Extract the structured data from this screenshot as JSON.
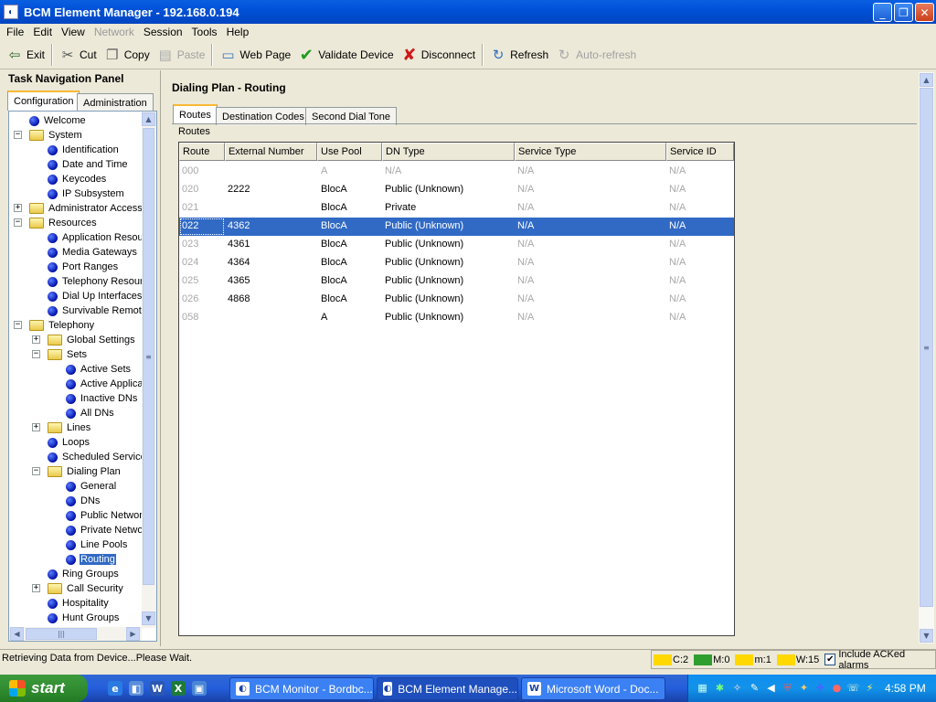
{
  "window": {
    "title": "BCM Element Manager - 192.168.0.194",
    "minimize": "_",
    "maximize": "❐",
    "close": "✕"
  },
  "menu": [
    "File",
    "Edit",
    "View",
    "Network",
    "Session",
    "Tools",
    "Help"
  ],
  "menu_disabled": [
    "Network"
  ],
  "toolbar": {
    "exit": "Exit",
    "cut": "Cut",
    "copy": "Copy",
    "paste": "Paste",
    "web_page": "Web Page",
    "validate_device": "Validate Device",
    "disconnect": "Disconnect",
    "refresh": "Refresh",
    "auto_refresh": "Auto-refresh"
  },
  "nav": {
    "title": "Task Navigation Panel",
    "tabs": {
      "configuration": "Configuration",
      "administration": "Administration"
    },
    "tree": [
      {
        "label": "Welcome",
        "type": "leaf",
        "level": 1
      },
      {
        "label": "System",
        "type": "folder",
        "level": 1,
        "expanded": true
      },
      {
        "label": "Identification",
        "type": "leaf",
        "level": 2
      },
      {
        "label": "Date and Time",
        "type": "leaf",
        "level": 2
      },
      {
        "label": "Keycodes",
        "type": "leaf",
        "level": 2
      },
      {
        "label": "IP Subsystem",
        "type": "leaf",
        "level": 2
      },
      {
        "label": "Administrator Access",
        "type": "folder",
        "level": 1,
        "expanded": false
      },
      {
        "label": "Resources",
        "type": "folder",
        "level": 1,
        "expanded": true
      },
      {
        "label": "Application Resou",
        "type": "leaf",
        "level": 2
      },
      {
        "label": "Media Gateways",
        "type": "leaf",
        "level": 2
      },
      {
        "label": "Port Ranges",
        "type": "leaf",
        "level": 2
      },
      {
        "label": "Telephony Resour",
        "type": "leaf",
        "level": 2
      },
      {
        "label": "Dial Up Interfaces",
        "type": "leaf",
        "level": 2
      },
      {
        "label": "Survivable Remote",
        "type": "leaf",
        "level": 2
      },
      {
        "label": "Telephony",
        "type": "folder",
        "level": 1,
        "expanded": true
      },
      {
        "label": "Global Settings",
        "type": "folder",
        "level": 2,
        "expanded": false
      },
      {
        "label": "Sets",
        "type": "folder",
        "level": 2,
        "expanded": true
      },
      {
        "label": "Active Sets",
        "type": "leaf",
        "level": 3
      },
      {
        "label": "Active Applica",
        "type": "leaf",
        "level": 3
      },
      {
        "label": "Inactive DNs",
        "type": "leaf",
        "level": 3
      },
      {
        "label": "All DNs",
        "type": "leaf",
        "level": 3
      },
      {
        "label": "Lines",
        "type": "folder",
        "level": 2,
        "expanded": false
      },
      {
        "label": "Loops",
        "type": "leaf",
        "level": 2
      },
      {
        "label": "Scheduled Service",
        "type": "leaf",
        "level": 2
      },
      {
        "label": "Dialing Plan",
        "type": "folder",
        "level": 2,
        "expanded": true
      },
      {
        "label": "General",
        "type": "leaf",
        "level": 3
      },
      {
        "label": "DNs",
        "type": "leaf",
        "level": 3
      },
      {
        "label": "Public Networ",
        "type": "leaf",
        "level": 3
      },
      {
        "label": "Private Netwo",
        "type": "leaf",
        "level": 3
      },
      {
        "label": "Line Pools",
        "type": "leaf",
        "level": 3
      },
      {
        "label": "Routing",
        "type": "leaf",
        "level": 3,
        "selected": true
      },
      {
        "label": "Ring Groups",
        "type": "leaf",
        "level": 2
      },
      {
        "label": "Call Security",
        "type": "folder",
        "level": 2,
        "expanded": false
      },
      {
        "label": "Hospitality",
        "type": "leaf",
        "level": 2
      },
      {
        "label": "Hunt Groups",
        "type": "leaf",
        "level": 2
      }
    ]
  },
  "content": {
    "title": "Dialing Plan - Routing",
    "tabs": {
      "routes": "Routes",
      "destination_codes": "Destination Codes",
      "second_dial_tone": "Second Dial Tone"
    },
    "group_label": "Routes",
    "columns": [
      "Route",
      "External Number",
      "Use Pool",
      "DN Type",
      "Service Type",
      "Service ID"
    ],
    "rows": [
      [
        "000",
        "",
        "A",
        "N/A",
        "N/A",
        "N/A"
      ],
      [
        "020",
        "2222",
        "BlocA",
        "Public (Unknown)",
        "N/A",
        "N/A"
      ],
      [
        "021",
        "",
        "BlocA",
        "Private",
        "N/A",
        "N/A"
      ],
      [
        "022",
        "4362",
        "BlocA",
        "Public (Unknown)",
        "N/A",
        "N/A"
      ],
      [
        "023",
        "4361",
        "BlocA",
        "Public (Unknown)",
        "N/A",
        "N/A"
      ],
      [
        "024",
        "4364",
        "BlocA",
        "Public (Unknown)",
        "N/A",
        "N/A"
      ],
      [
        "025",
        "4365",
        "BlocA",
        "Public (Unknown)",
        "N/A",
        "N/A"
      ],
      [
        "026",
        "4868",
        "BlocA",
        "Public (Unknown)",
        "N/A",
        "N/A"
      ],
      [
        "058",
        "",
        "A",
        "Public (Unknown)",
        "N/A",
        "N/A"
      ]
    ],
    "selected_row": 3
  },
  "status": {
    "message": "Retrieving Data from Device...Please Wait.",
    "alarms": [
      {
        "label": "C:2",
        "color": "#ffd800"
      },
      {
        "label": "M:0",
        "color": "#2e9e2e"
      },
      {
        "label": "m:1",
        "color": "#ffd800"
      },
      {
        "label": "W:15",
        "color": "#ffd800"
      }
    ],
    "include_acked": "Include ACKed alarms"
  },
  "taskbar": {
    "start": "start",
    "tasks": [
      "BCM Monitor - Bordbc...",
      "BCM Element Manage...",
      "Microsoft Word - Doc..."
    ],
    "active_task": 1,
    "clock": "4:58 PM"
  }
}
